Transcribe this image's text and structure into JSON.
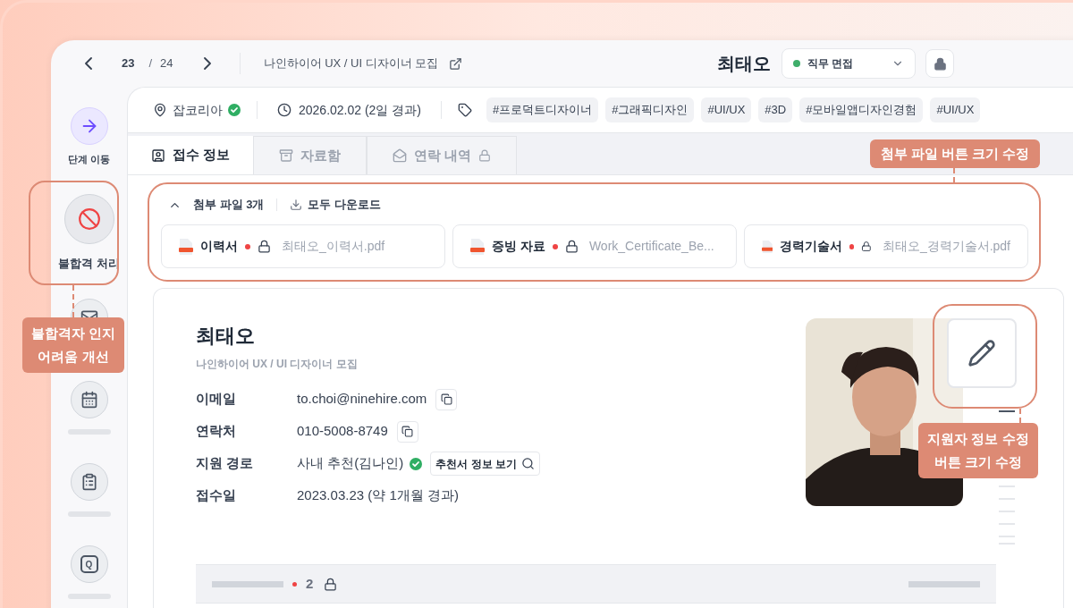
{
  "nav": {
    "current": "23",
    "separator": "/",
    "total": "24",
    "job_title": "나인하이어 UX / UI 디자이너 모집"
  },
  "header": {
    "name": "최태오",
    "stage": {
      "label": "직무 면접",
      "color": "#3fae6a"
    },
    "locked": true
  },
  "rail": {
    "actions": [
      {
        "label": "단계 이동",
        "kind": "move"
      },
      {
        "label": "불합격 처리",
        "kind": "reject"
      }
    ],
    "q_badge": "Q"
  },
  "source_bar": {
    "source": "잡코리아",
    "verified": true,
    "date": "2026.02.02 (2일 경과)",
    "tags": [
      "#프로덕트디자이너",
      "#그래픽디자인",
      "#UI/UX",
      "#3D",
      "#모바일앱디자인경험",
      "#UI/UX"
    ]
  },
  "tabs": [
    {
      "label": "접수 정보",
      "selected": true,
      "locked": false
    },
    {
      "label": "자료함",
      "selected": false,
      "locked": false
    },
    {
      "label": "연락 내역",
      "selected": false,
      "locked": true
    }
  ],
  "attachments": {
    "title": "첨부 파일 3개",
    "expanded": true,
    "download_all": "모두 다운로드",
    "files": [
      {
        "label": "이력서",
        "new": true,
        "locked": true,
        "filename": "최태오_이력서.pdf"
      },
      {
        "label": "증빙 자료",
        "new": true,
        "locked": true,
        "filename": "Work_Certificate_Be..."
      },
      {
        "label": "경력기술서",
        "new": true,
        "locked": true,
        "filename": "최태오_경력기술서.pdf"
      }
    ]
  },
  "profile": {
    "name": "최태오",
    "job": "나인하이어 UX / UI 디자이너 모집",
    "fields": [
      {
        "label": "이메일",
        "value": "to.choi@ninehire.com",
        "kind": "copy"
      },
      {
        "label": "연락처",
        "value": "010-5008-8749",
        "kind": "copy"
      },
      {
        "label": "지원 경로",
        "value": "사내 추천(김나인)",
        "kind": "referral",
        "verified": true,
        "action": "추천서 정보 보기"
      },
      {
        "label": "접수일",
        "value": "2023.03.23 (약 1개월 경과)",
        "kind": "plain"
      }
    ]
  },
  "section_bar": {
    "count": "2",
    "new": true,
    "locked": true
  },
  "annotations": [
    {
      "text": "첨부 파일 버튼 크기 수정"
    },
    {
      "text": "불합격자 인지 어려움 개선"
    },
    {
      "text": "지원자 정보 수정 버튼 크기 수정"
    }
  ]
}
